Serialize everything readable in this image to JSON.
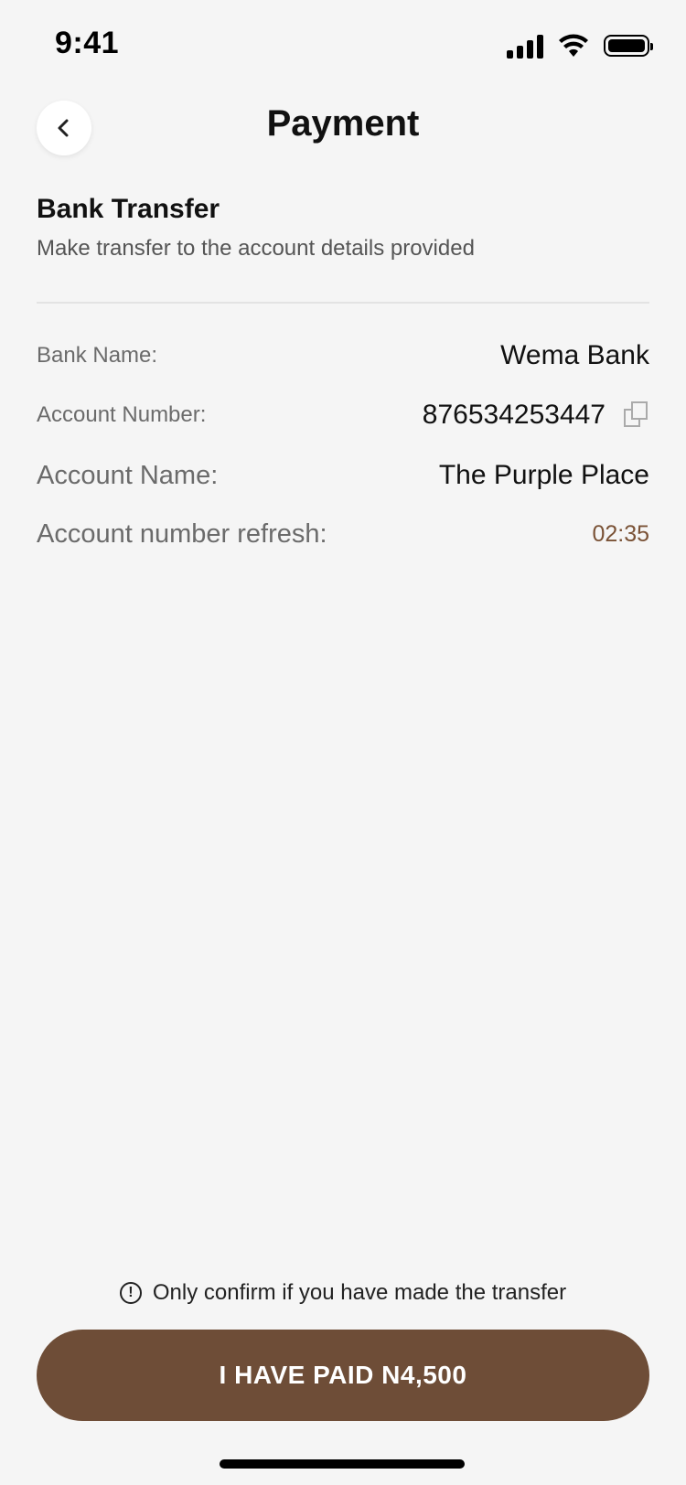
{
  "status": {
    "time": "9:41",
    "icons": [
      "signal-icon",
      "wifi-icon",
      "battery-icon"
    ]
  },
  "header": {
    "title": "Payment",
    "back_icon": "chevron-left-icon"
  },
  "section": {
    "title": "Bank Transfer",
    "subtitle": "Make transfer to the account details provided"
  },
  "details": {
    "bank_name_label": "Bank Name:",
    "bank_name_value": "Wema Bank",
    "account_number_label": "Account Number:",
    "account_number_value": "876534253447",
    "copy_icon": "copy-icon",
    "account_name_label": "Account Name:",
    "account_name_value": "The Purple Place",
    "refresh_label": "Account number refresh:",
    "refresh_value": "02:35"
  },
  "notice": {
    "text": "Only confirm if you have made the transfer",
    "icon": "info-icon"
  },
  "cta": {
    "label": "I HAVE PAID N4,500"
  },
  "colors": {
    "accent": "#6e4d37",
    "background": "#f5f5f5",
    "timer": "#7a5236"
  }
}
